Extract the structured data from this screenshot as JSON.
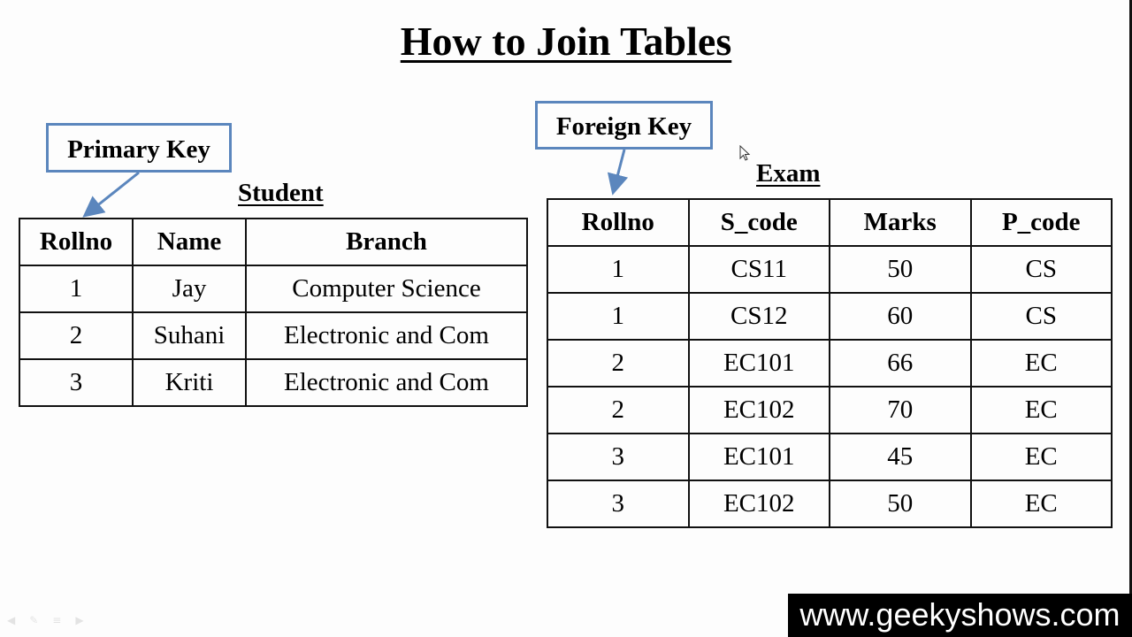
{
  "slide": {
    "title": "How to Join Tables",
    "primary_key_label": "Primary Key",
    "foreign_key_label": "Foreign Key"
  },
  "student": {
    "caption": "Student",
    "headers": [
      "Rollno",
      "Name",
      "Branch"
    ],
    "rows": [
      [
        "1",
        "Jay",
        "Computer Science"
      ],
      [
        "2",
        "Suhani",
        "Electronic and Com"
      ],
      [
        "3",
        "Kriti",
        "Electronic and Com"
      ]
    ]
  },
  "exam": {
    "caption": "Exam",
    "headers": [
      "Rollno",
      "S_code",
      "Marks",
      "P_code"
    ],
    "rows": [
      [
        "1",
        "CS11",
        "50",
        "CS"
      ],
      [
        "1",
        "CS12",
        "60",
        "CS"
      ],
      [
        "2",
        "EC101",
        "66",
        "EC"
      ],
      [
        "2",
        "EC102",
        "70",
        "EC"
      ],
      [
        "3",
        "EC101",
        "45",
        "EC"
      ],
      [
        "3",
        "EC102",
        "50",
        "EC"
      ]
    ]
  },
  "controls": {
    "icons": [
      "prev-icon",
      "pen-icon",
      "menu-icon",
      "next-icon"
    ],
    "glyphs": [
      "◀",
      "✎",
      "≡",
      "▶"
    ]
  },
  "watermark": "www.geekyshows.com",
  "colors": {
    "callout_border": "#5b86bd",
    "arrow": "#5b86bd",
    "watermark_bg": "#000000"
  }
}
